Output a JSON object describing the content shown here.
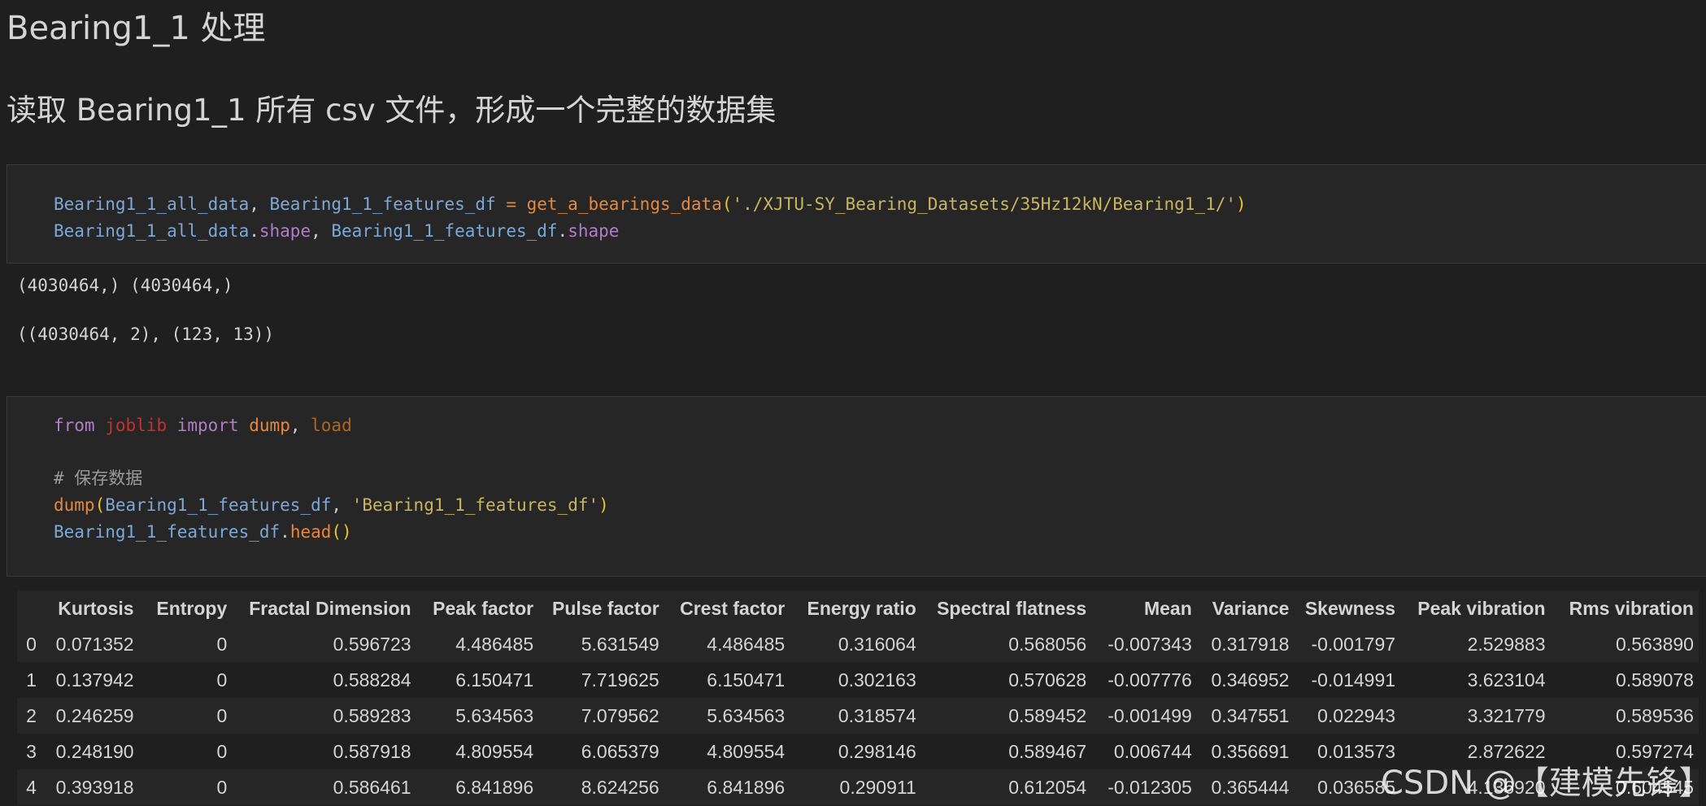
{
  "heading1": "Bearing1_1 处理",
  "heading2": "读取 Bearing1_1 所有 csv 文件，形成一个完整的数据集",
  "cell1": {
    "line1": {
      "v1": "Bearing1_1_all_data",
      "sep1": ", ",
      "v2": "Bearing1_1_features_df",
      "eq": " = ",
      "fn": "get_a_bearings_data",
      "p1": "(",
      "str": "'./XJTU-SY_Bearing_Datasets/35Hz12kN/Bearing1_1/'",
      "p2": ")"
    },
    "line2": {
      "v1": "Bearing1_1_all_data",
      "dot1": ".",
      "a1": "shape",
      "sep": ", ",
      "v2": "Bearing1_1_features_df",
      "dot2": ".",
      "a2": "shape"
    }
  },
  "outputs": {
    "out1": "(4030464,) (4030464,)",
    "out2": "((4030464, 2), (123, 13))"
  },
  "cell2": {
    "line1": {
      "kw1": "from",
      "sp1": " ",
      "mod": "joblib",
      "sp2": " ",
      "kw2": "import",
      "sp3": " ",
      "n1": "dump",
      "sep": ", ",
      "n2": "load"
    },
    "comment": "# 保存数据",
    "line3": {
      "fn": "dump",
      "p1": "(",
      "v": "Bearing1_1_features_df",
      "sep": ", ",
      "str": "'Bearing1_1_features_df'",
      "p2": ")"
    },
    "line4": {
      "v": "Bearing1_1_features_df",
      "dot": ".",
      "fn": "head",
      "p": "()"
    }
  },
  "table": {
    "columns": [
      "",
      "Kurtosis",
      "Entropy",
      "Fractal Dimension",
      "Peak factor",
      "Pulse factor",
      "Crest factor",
      "Energy ratio",
      "Spectral flatness",
      "Mean",
      "Variance",
      "Skewness",
      "Peak vibration",
      "Rms vibration"
    ],
    "rows": [
      [
        "0",
        "0.071352",
        "0",
        "0.596723",
        "4.486485",
        "5.631549",
        "4.486485",
        "0.316064",
        "0.568056",
        "-0.007343",
        "0.317918",
        "-0.001797",
        "2.529883",
        "0.563890"
      ],
      [
        "1",
        "0.137942",
        "0",
        "0.588284",
        "6.150471",
        "7.719625",
        "6.150471",
        "0.302163",
        "0.570628",
        "-0.007776",
        "0.346952",
        "-0.014991",
        "3.623104",
        "0.589078"
      ],
      [
        "2",
        "0.246259",
        "0",
        "0.589283",
        "5.634563",
        "7.079562",
        "5.634563",
        "0.318574",
        "0.589452",
        "-0.001499",
        "0.347551",
        "0.022943",
        "3.321779",
        "0.589536"
      ],
      [
        "3",
        "0.248190",
        "0",
        "0.587918",
        "4.809554",
        "6.065379",
        "4.809554",
        "0.298146",
        "0.589467",
        "0.006744",
        "0.356691",
        "0.013573",
        "2.872622",
        "0.597274"
      ],
      [
        "4",
        "0.393918",
        "0",
        "0.586461",
        "6.841896",
        "8.624256",
        "6.841896",
        "0.290911",
        "0.612054",
        "-0.012305",
        "0.365444",
        "0.036585",
        "4.136920",
        "0.604545"
      ]
    ]
  },
  "watermark": "CSDN @【建模先锋】"
}
